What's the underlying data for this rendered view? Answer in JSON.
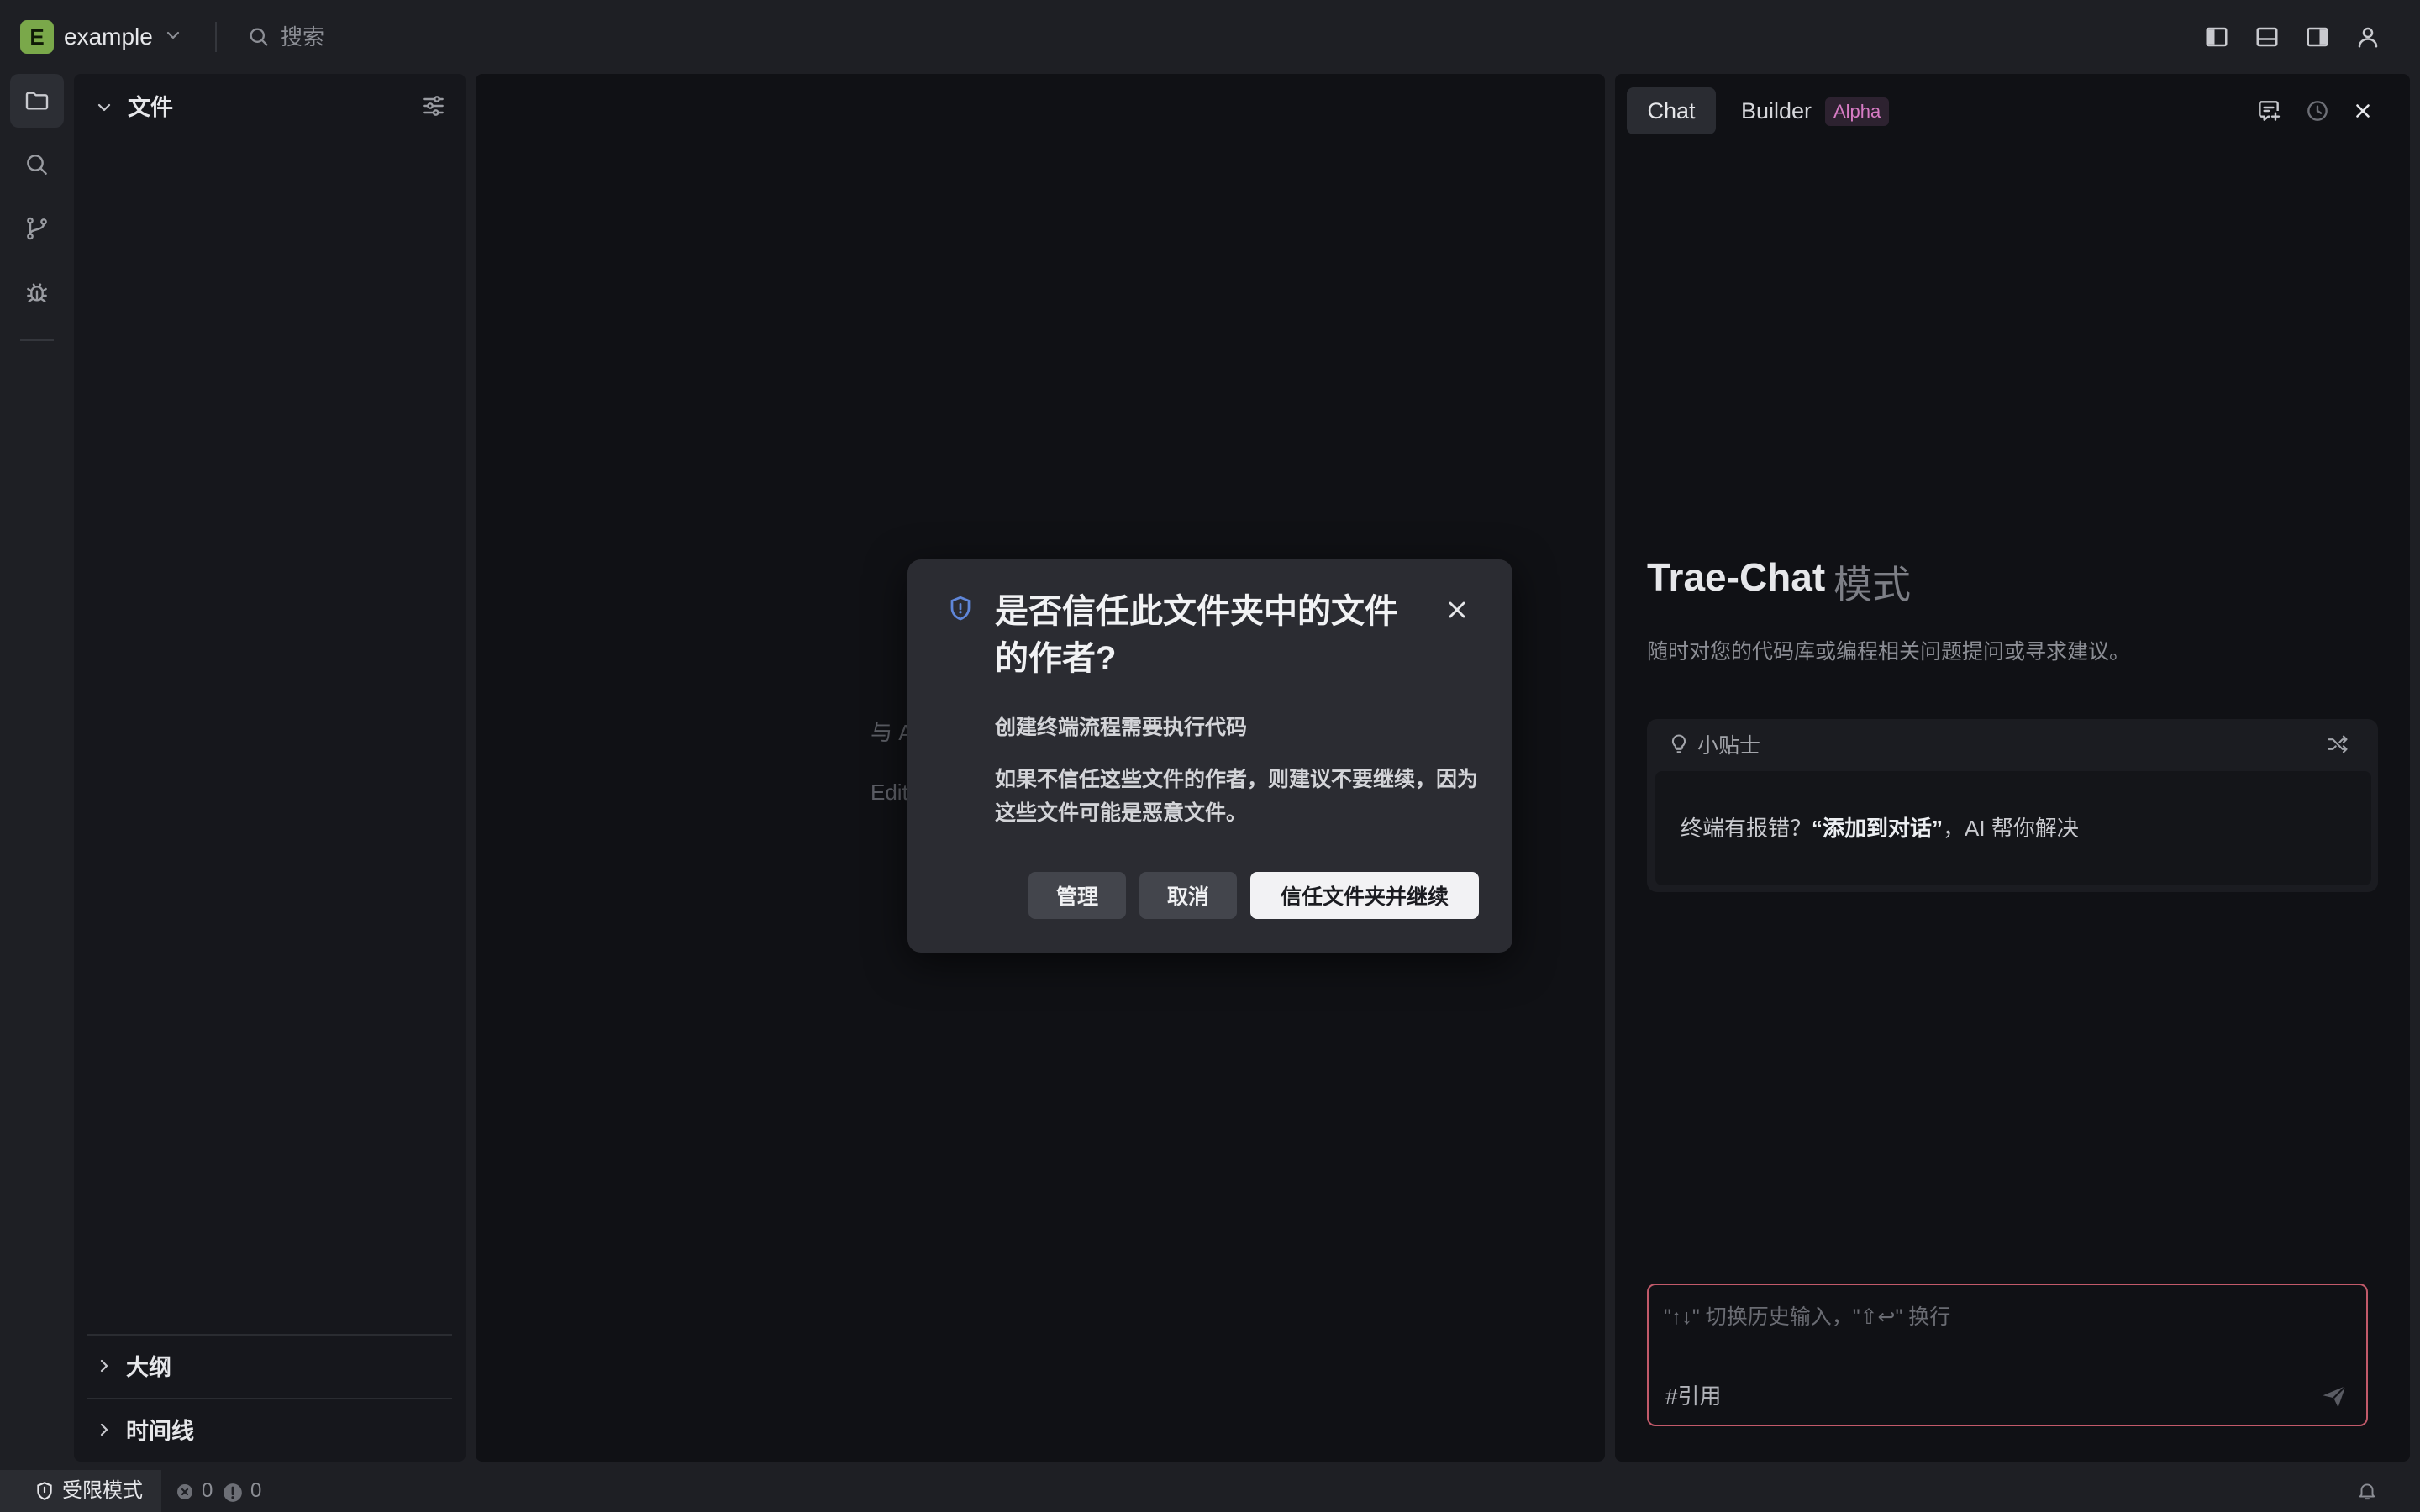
{
  "titlebar": {
    "workspace_badge": "E",
    "workspace_name": "example",
    "search_placeholder": "搜索",
    "icons": [
      "toggle-sidebar-left-icon",
      "toggle-panel-bottom-icon",
      "toggle-sidebar-right-icon",
      "account-icon"
    ]
  },
  "activity_bar": {
    "items": [
      "files-icon",
      "search-icon",
      "source-control-icon",
      "debug-icon"
    ],
    "active": "files-icon"
  },
  "explorer": {
    "title": "文件",
    "sections": {
      "outline": "大纲",
      "timeline": "时间线"
    }
  },
  "editor": {
    "hint_line1": "与 A",
    "hint_line2": "Edit"
  },
  "chat": {
    "tabs": [
      {
        "label": "Chat",
        "active": true
      },
      {
        "label": "Builder",
        "badge": "Alpha"
      }
    ],
    "title": "Trae-Chat",
    "title_mode": "模式",
    "subtitle": "随时对您的代码库或编程相关问题提问或寻求建议。",
    "tips": {
      "label": "小贴士",
      "text_prefix": "终端有报错？",
      "text_bold": "“添加到对话”",
      "text_suffix": "，AI 帮你解决"
    },
    "input": {
      "placeholder": "\"↑↓\" 切换历史输入，\"⇧↩\" 换行",
      "reference_label": "#引用"
    }
  },
  "statusbar": {
    "restricted_mode": "受限模式",
    "errors": "0",
    "warnings": "0"
  },
  "modal": {
    "title": "是否信任此文件夹中的文件的作者?",
    "line1": "创建终端流程需要执行代码",
    "line2": "如果不信任这些文件的作者，则建议不要继续，因为这些文件可能是恶意文件。",
    "buttons": {
      "manage": "管理",
      "cancel": "取消",
      "trust": "信任文件夹并继续"
    }
  },
  "colors": {
    "background": "#1e1f24",
    "panel": "#101115",
    "accent_alpha": "#d77bc4",
    "input_border": "#c25a6a",
    "workspace_badge": "#7aa84a",
    "shield": "#5f86d9"
  }
}
